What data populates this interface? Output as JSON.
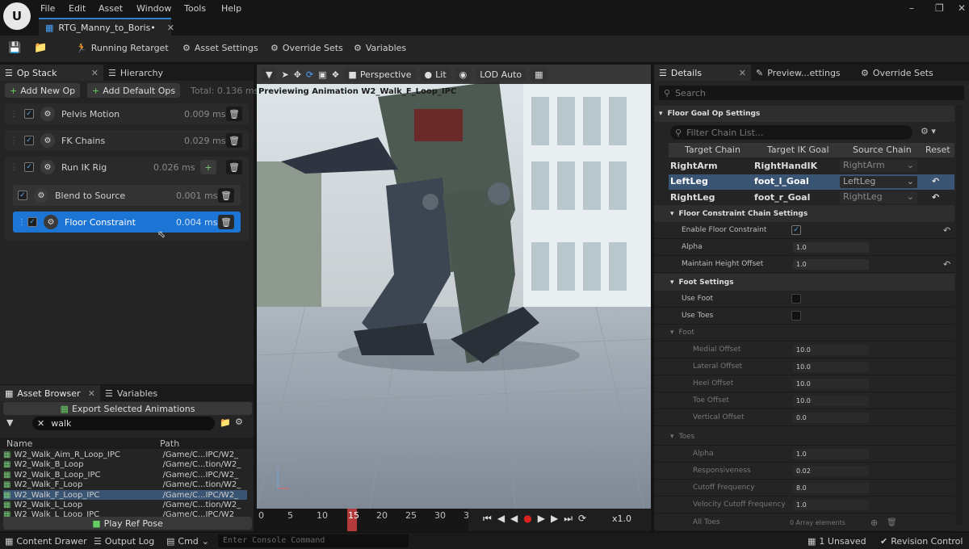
{
  "menu": [
    "File",
    "Edit",
    "Asset",
    "Window",
    "Tools",
    "Help"
  ],
  "doc_tab": "RTG_Manny_to_Boris•",
  "toolbar": {
    "running_retarget": "Running Retarget",
    "asset_settings": "Asset Settings",
    "override_sets": "Override Sets",
    "variables": "Variables"
  },
  "left_tabs": {
    "op_stack": "Op Stack",
    "hierarchy": "Hierarchy"
  },
  "opstack": {
    "add_new_op": "Add New Op",
    "add_default_ops": "Add Default Ops",
    "total": "Total: 0.136 ms",
    "ops": [
      {
        "name": "Pelvis Motion",
        "ms": "0.009 ms"
      },
      {
        "name": "FK Chains",
        "ms": "0.029 ms"
      },
      {
        "name": "Run IK Rig",
        "ms": "0.026 ms"
      },
      {
        "name": "Blend to Source",
        "ms": "0.001 ms"
      },
      {
        "name": "Floor Constraint",
        "ms": "0.004 ms"
      }
    ]
  },
  "asset_browser": {
    "tab": "Asset Browser",
    "tab2": "Variables",
    "export": "Export Selected Animations",
    "search": "walk",
    "col_name": "Name",
    "col_path": "Path",
    "rows": [
      {
        "name": "W2_Walk_Aim_R_Loop_IPC",
        "path": "/Game/C...IPC/W2_"
      },
      {
        "name": "W2_Walk_B_Loop",
        "path": "/Game/C...tion/W2_"
      },
      {
        "name": "W2_Walk_B_Loop_IPC",
        "path": "/Game/C...IPC/W2_"
      },
      {
        "name": "W2_Walk_F_Loop",
        "path": "/Game/C...tion/W2_"
      },
      {
        "name": "W2_Walk_F_Loop_IPC",
        "path": "/Game/C...IPC/W2_"
      },
      {
        "name": "W2_Walk_L_Loop",
        "path": "/Game/C...tion/W2_"
      },
      {
        "name": "W2_Walk_L_Loop_IPC",
        "path": "/Game/C...IPC/W2_"
      }
    ],
    "play_ref": "Play Ref Pose"
  },
  "viewport": {
    "perspective": "Perspective",
    "lit": "Lit",
    "lod": "LOD Auto",
    "preview": "Previewing Animation W2_Walk_F_Loop_IPC"
  },
  "timeline": {
    "ticks": [
      "0",
      "5",
      "10",
      "15",
      "20",
      "25",
      "30",
      "3"
    ],
    "speed": "x1.0"
  },
  "details": {
    "tab1": "Details",
    "tab2": "Preview...ettings",
    "tab3": "Override Sets",
    "search": "Search",
    "section": "Floor Goal Op Settings",
    "filter": "Filter Chain List...",
    "headers": [
      "Target Chain",
      "Target IK Goal",
      "Source Chain",
      "Reset"
    ],
    "chains": [
      {
        "target": "RightArm",
        "goal": "RightHandIK",
        "source": "RightArm"
      },
      {
        "target": "LeftLeg",
        "goal": "foot_l_Goal",
        "source": "LeftLeg"
      },
      {
        "target": "RightLeg",
        "goal": "foot_r_Goal",
        "source": "RightLeg"
      }
    ],
    "chain_settings": "Floor Constraint Chain Settings",
    "enable_floor": "Enable Floor Constraint",
    "alpha": "Alpha",
    "alpha_val": "1.0",
    "maintain": "Maintain Height Offset",
    "maintain_val": "1.0",
    "foot_settings": "Foot Settings",
    "use_foot": "Use Foot",
    "use_toes": "Use Toes",
    "foot": "Foot",
    "foot_rows": [
      {
        "label": "Medial Offset",
        "val": "10.0"
      },
      {
        "label": "Lateral Offset",
        "val": "10.0"
      },
      {
        "label": "Heel Offset",
        "val": "10.0"
      },
      {
        "label": "Toe Offset",
        "val": "10.0"
      },
      {
        "label": "Vertical Offset",
        "val": "0.0"
      }
    ],
    "toes": "Toes",
    "toe_rows": [
      {
        "label": "Alpha",
        "val": "1.0"
      },
      {
        "label": "Responsiveness",
        "val": "0.02"
      },
      {
        "label": "Cutoff Frequency",
        "val": "8.0"
      },
      {
        "label": "Velocity Cutoff Frequency",
        "val": "1.0"
      }
    ],
    "all_toes": "All Toes",
    "array": "0 Array elements"
  },
  "status": {
    "content_drawer": "Content Drawer",
    "output_log": "Output Log",
    "cmd": "Cmd",
    "console": "Enter Console Command",
    "unsaved": "1 Unsaved",
    "revision": "Revision Control"
  }
}
